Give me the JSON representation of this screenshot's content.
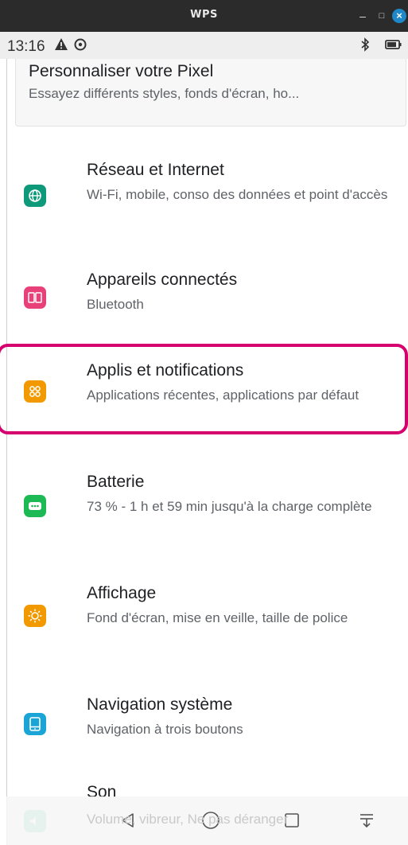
{
  "window": {
    "title": "WPS",
    "minimize_glyph": "–",
    "maximize_glyph": "□",
    "close_glyph": "×"
  },
  "status_bar": {
    "time": "13:16",
    "icons": [
      "warning-icon",
      "sync-icon",
      "bluetooth-icon",
      "battery-icon"
    ]
  },
  "top_card": {
    "title": "Personnaliser votre Pixel",
    "subtitle": "Essayez différents styles, fonds d'écran, ho..."
  },
  "settings": [
    {
      "title": "Réseau et Internet",
      "subtitle": "Wi-Fi, mobile, conso des données et point d'accès",
      "icon": "globe-icon",
      "color": "#0e9a7a"
    },
    {
      "title": "Appareils connectés",
      "subtitle": "Bluetooth",
      "icon": "devices-icon",
      "color": "#e8417a"
    },
    {
      "title": "Applis et notifications",
      "subtitle": "Applications récentes, applications par défaut",
      "icon": "apps-icon",
      "color": "#f29900"
    },
    {
      "title": "Batterie",
      "subtitle": "73 % - 1 h et 59 min jusqu'à la charge complète",
      "icon": "battery-icon",
      "color": "#1db954"
    },
    {
      "title": "Affichage",
      "subtitle": "Fond d'écran, mise en veille, taille de police",
      "icon": "brightness-icon",
      "color": "#f29900"
    },
    {
      "title": "Navigation système",
      "subtitle": "Navigation à trois boutons",
      "icon": "navigation-icon",
      "color": "#1aa5d6"
    },
    {
      "title": "Son",
      "subtitle": "Volume, vibreur, Ne pas déranger",
      "icon": "volume-icon",
      "color": "#1db98a"
    }
  ],
  "highlight_color": "#d5006d",
  "nav_bar": [
    "back-icon",
    "home-icon",
    "recents-icon",
    "expand-icon"
  ]
}
